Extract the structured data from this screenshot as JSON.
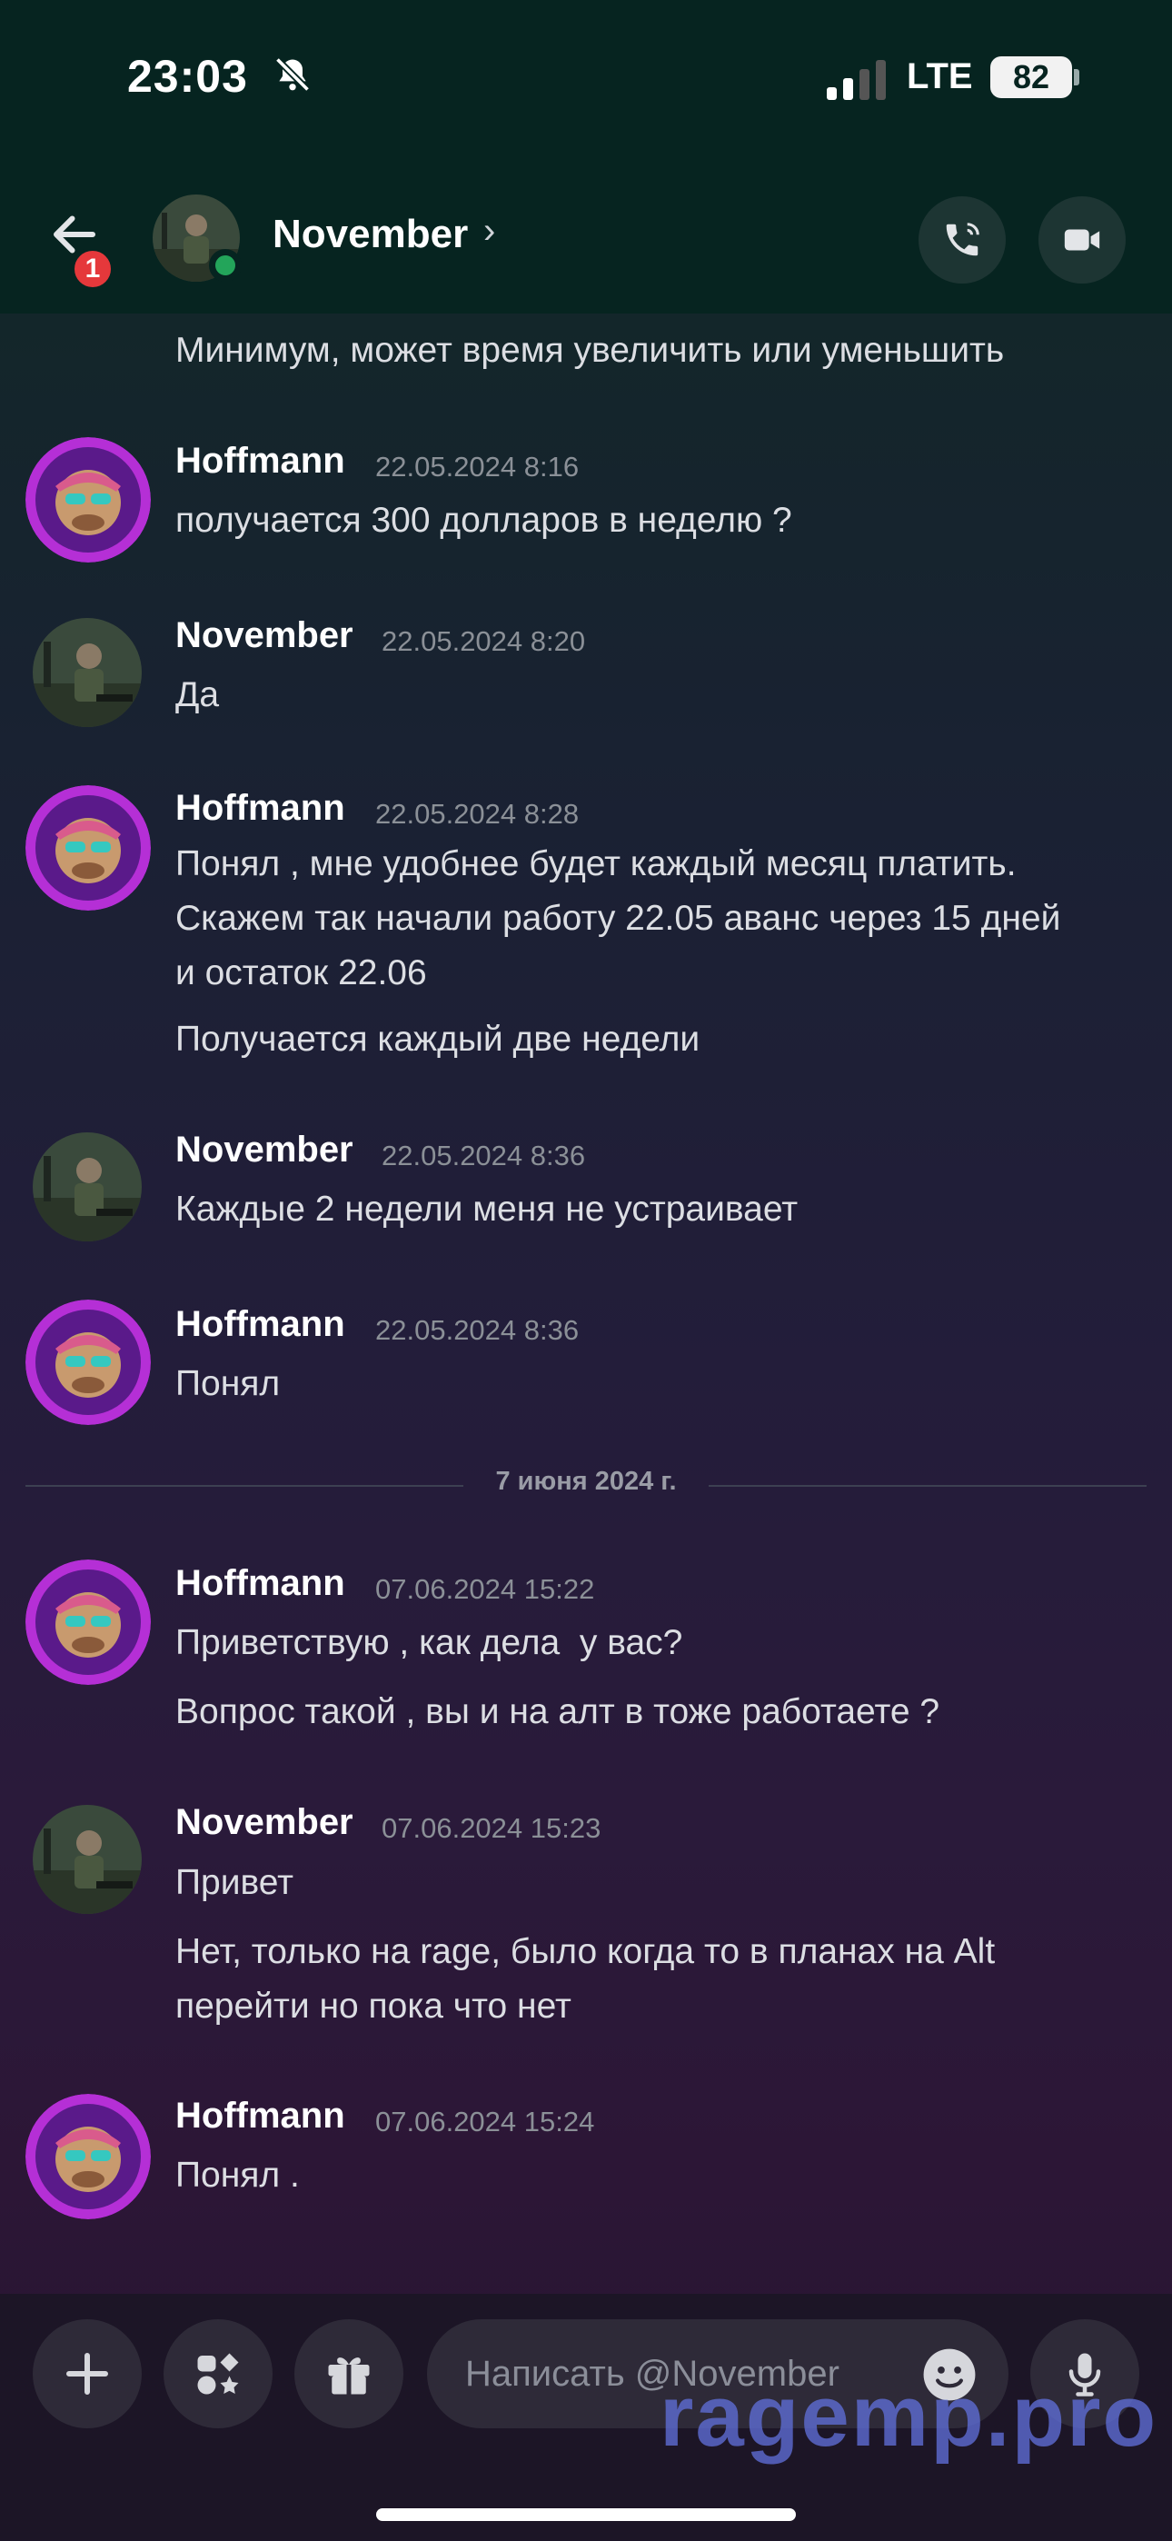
{
  "status": {
    "time": "23:03",
    "network": "LTE",
    "battery": "82"
  },
  "header": {
    "contact_name": "November",
    "unread_badge": "1"
  },
  "messages": {
    "cont0": "Минимум, может время увеличить или уменьшить",
    "g1": {
      "author": "Hoffmann",
      "time": "22.05.2024 8:16",
      "lines": [
        "получается 300 долларов в неделю ?"
      ]
    },
    "g2": {
      "author": "November",
      "time": "22.05.2024 8:20",
      "lines": [
        "Да"
      ]
    },
    "g3": {
      "author": "Hoffmann",
      "time": "22.05.2024 8:28",
      "lines": [
        "Понял , мне удобнее будет каждый месяц платить.",
        "Скажем так начали работу 22.05 аванс через 15 дней",
        "и остаток 22.06",
        "Получается каждый две недели"
      ]
    },
    "g4": {
      "author": "November",
      "time": "22.05.2024 8:36",
      "lines": [
        "Каждые 2 недели меня не устраивает"
      ]
    },
    "g5": {
      "author": "Hoffmann",
      "time": "22.05.2024 8:36",
      "lines": [
        "Понял"
      ]
    },
    "divider": "7 июня 2024 г.",
    "g6": {
      "author": "Hoffmann",
      "time": "07.06.2024 15:22",
      "lines": [
        "Приветствую , как дела  у вас?",
        "Вопрос такой , вы и на алт в тоже работаете ?"
      ]
    },
    "g7": {
      "author": "November",
      "time": "07.06.2024 15:23",
      "lines": [
        "Привет",
        "Нет, только на rage, было когда то в планах на Alt",
        "перейти но пока что нет"
      ]
    },
    "g8": {
      "author": "Hoffmann",
      "time": "07.06.2024 15:24",
      "lines": [
        "Понял ."
      ]
    }
  },
  "composer": {
    "placeholder": "Написать @November"
  },
  "watermark": "ragemp.pro",
  "colors": {
    "online": "#23a55a",
    "badge": "#e5383b",
    "header_bg": "#062420"
  },
  "icons": [
    "back-arrow-icon",
    "phone-icon",
    "video-camera-icon",
    "plus-icon",
    "apps-icon",
    "gift-icon",
    "emoji-icon",
    "microphone-icon",
    "bell-off-icon",
    "chevron-right-icon"
  ]
}
